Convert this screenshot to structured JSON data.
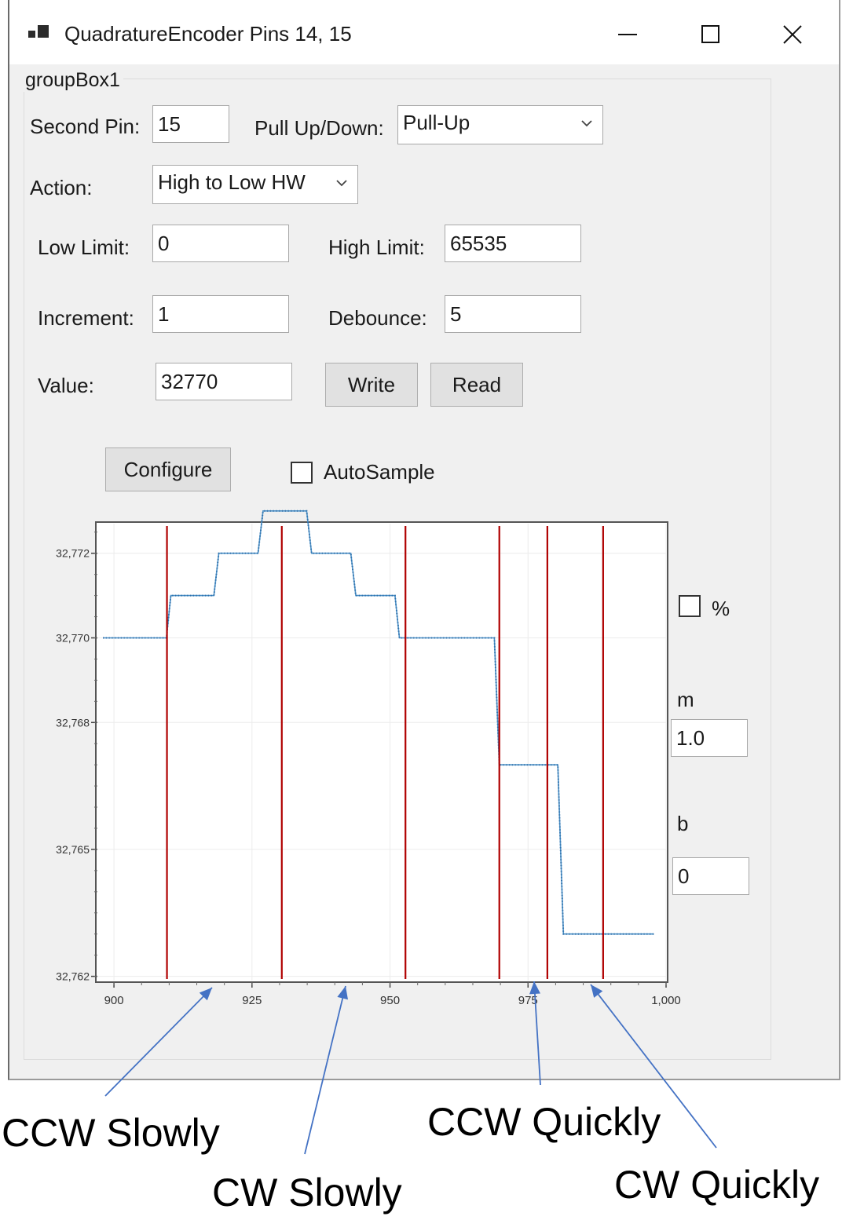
{
  "window": {
    "title": "QuadratureEncoder Pins 14, 15",
    "icons": {
      "app": "app-icon",
      "minimize": "minimize-icon",
      "maximize": "maximize-icon",
      "close": "close-icon"
    }
  },
  "groupbox": {
    "title": "groupBox1"
  },
  "form": {
    "second_pin_label": "Second Pin:",
    "second_pin_value": "15",
    "pull_label": "Pull Up/Down:",
    "pull_value": "Pull-Up",
    "action_label": "Action:",
    "action_value": "High to Low HW",
    "low_limit_label": "Low Limit:",
    "low_limit_value": "0",
    "high_limit_label": "High Limit:",
    "high_limit_value": "65535",
    "increment_label": "Increment:",
    "increment_value": "1",
    "debounce_label": "Debounce:",
    "debounce_value": "5",
    "value_label": "Value:",
    "value_value": "32770",
    "write_button": "Write",
    "read_button": "Read",
    "configure_button": "Configure",
    "autosample_label": "AutoSample",
    "autosample_checked": false
  },
  "side": {
    "percent_label": "%",
    "percent_checked": false,
    "m_label": "m",
    "m_value": "1.0",
    "b_label": "b",
    "b_value": "0"
  },
  "annotations": {
    "ccw_slowly": "CCW Slowly",
    "cw_slowly": "CW Slowly",
    "ccw_quickly": "CCW Quickly",
    "cw_quickly": "CW Quickly",
    "arrow_color": "#4472c4"
  },
  "chart_data": {
    "type": "line",
    "x_range": [
      897,
      1000
    ],
    "y_range": [
      32761.9,
      32772.7
    ],
    "x_ticks": [
      900,
      925,
      950,
      975,
      1000
    ],
    "x_tick_labels": [
      "900",
      "925",
      "950",
      "975",
      "1,000"
    ],
    "y_ticks": [
      32762,
      32765,
      32768,
      32770,
      32772
    ],
    "y_tick_labels": [
      "32,762",
      "32,765",
      "32,768",
      "32,770",
      "32,772"
    ],
    "series": [
      {
        "color": "#4a90c8",
        "points": [
          [
            898,
            32770
          ],
          [
            909.5,
            32770
          ],
          [
            910.3,
            32771
          ],
          [
            918.1,
            32771
          ],
          [
            919,
            32772
          ],
          [
            926.1,
            32772
          ],
          [
            927,
            32773
          ],
          [
            934.9,
            32773
          ],
          [
            935.8,
            32772
          ],
          [
            942.9,
            32772
          ],
          [
            943.8,
            32771
          ],
          [
            950.9,
            32771
          ],
          [
            951.7,
            32770
          ],
          [
            968.9,
            32770
          ],
          [
            969.8,
            32767
          ],
          [
            980.4,
            32767
          ],
          [
            981.4,
            32763
          ],
          [
            997.8,
            32763
          ]
        ]
      }
    ],
    "markers": [
      {
        "color": "#b00000",
        "x": [
          909.6,
          930.4,
          952.8,
          969.8,
          978.5,
          988.6
        ]
      }
    ],
    "grid": true
  }
}
